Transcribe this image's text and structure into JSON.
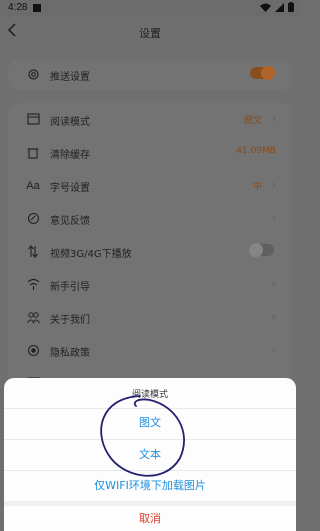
{
  "status_bar": {
    "time": "4:28"
  },
  "header": {
    "title": "设置"
  },
  "push": {
    "label": "推送设置",
    "enabled": true
  },
  "settings": [
    {
      "label": "阅读模式",
      "value": "图文",
      "icon": "book-icon",
      "chevron": true
    },
    {
      "label": "清除缓存",
      "value": "41.09MB",
      "icon": "trash-icon",
      "chevron": false
    },
    {
      "label": "字号设置",
      "value": "中",
      "icon": "font-size-icon",
      "chevron": true
    },
    {
      "label": "意见反馈",
      "value": "",
      "icon": "feedback-icon",
      "chevron": true
    },
    {
      "label": "视频3G/4G下播放",
      "value": "",
      "icon": "data-transfer-icon",
      "toggle": false
    },
    {
      "label": "新手引导",
      "value": "",
      "icon": "guide-icon",
      "chevron": true
    },
    {
      "label": "关于我们",
      "value": "",
      "icon": "team-icon",
      "chevron": true
    },
    {
      "label": "隐私政策",
      "value": "",
      "icon": "privacy-icon",
      "chevron": true
    },
    {
      "label": "",
      "value": "",
      "icon": "partial-icon",
      "chevron": true
    }
  ],
  "sheet": {
    "title": "阅读模式",
    "options": [
      "图文",
      "文本",
      "仅WIFI环境下加载图片"
    ],
    "cancel": "取消"
  },
  "colors": {
    "accent": "#1d8fe0",
    "cancel": "#e03a2a",
    "toggle_on": "#b0642a"
  }
}
